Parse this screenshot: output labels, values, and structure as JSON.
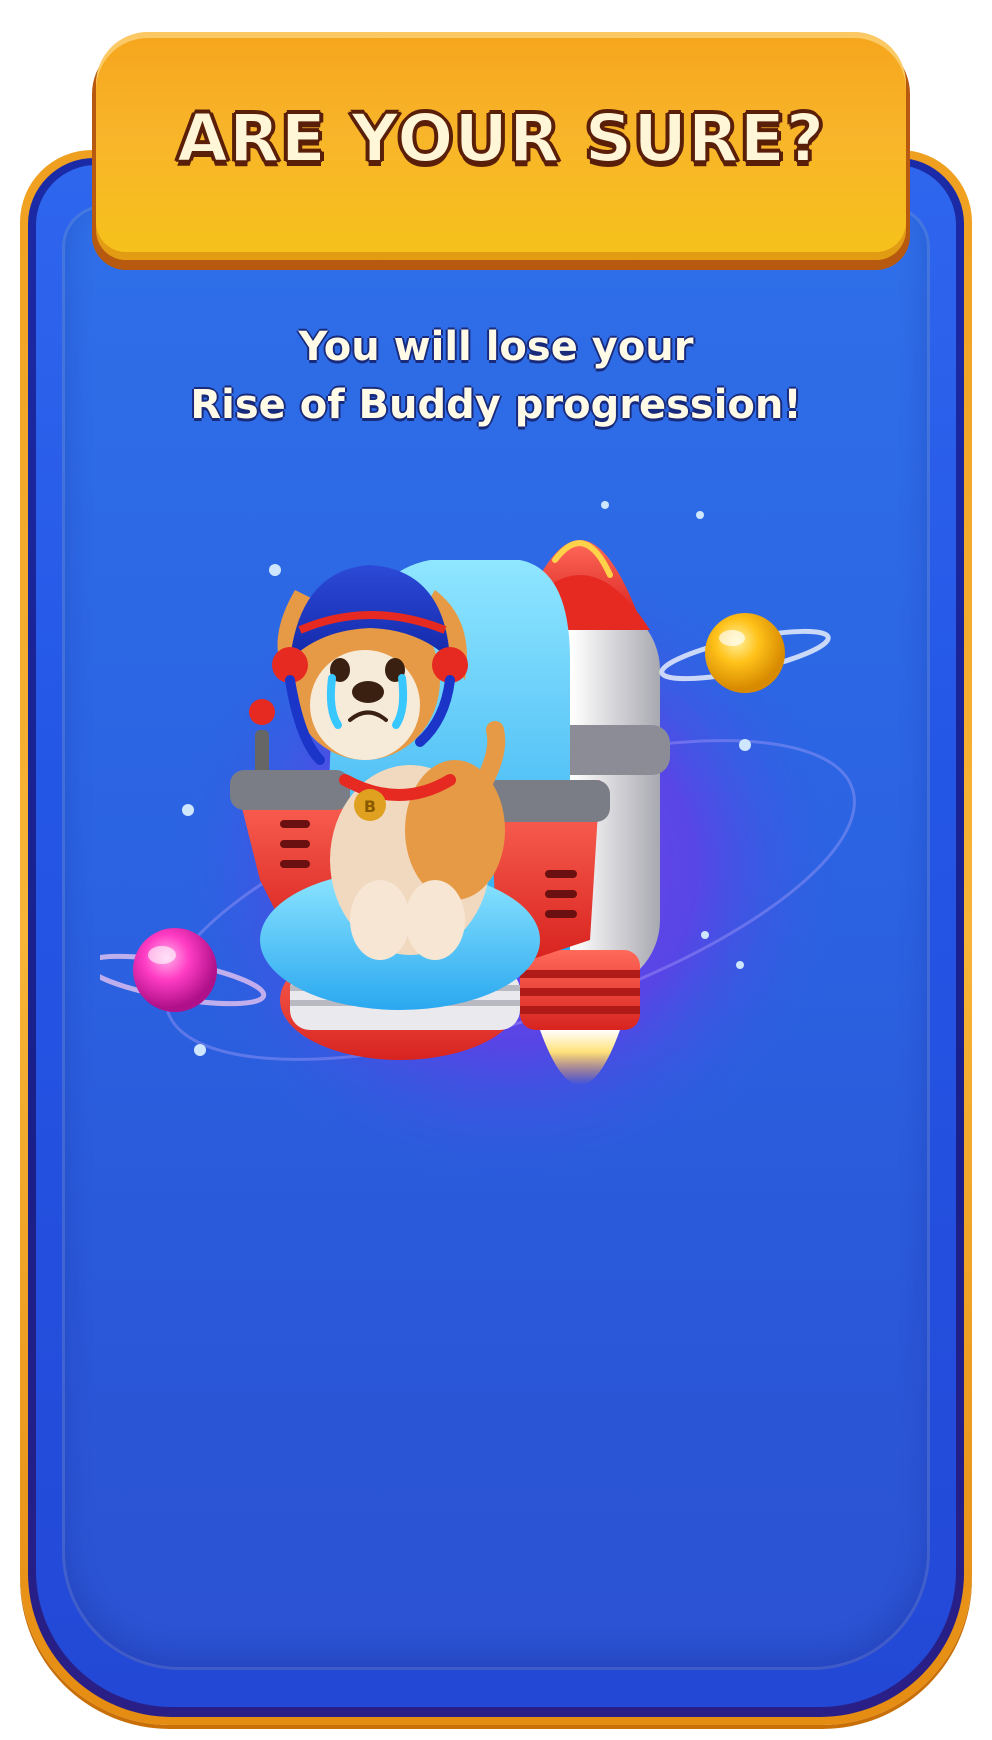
{
  "dialog": {
    "title": "ARE YOUR SURE?",
    "message_line1": "You will lose your",
    "message_line2": "Rise of Buddy progression!",
    "illustration": {
      "subject": "crying puppy astronaut on rocket chair",
      "collar_tag": "B"
    }
  },
  "colors": {
    "rim_orange": "#f0a020",
    "frame_blue": "#2f66ee",
    "inner_blue": "#2b63e2",
    "header_yellow": "#f8b52a",
    "title_outline": "#5a1f08",
    "text_cream": "#fffbe6"
  }
}
